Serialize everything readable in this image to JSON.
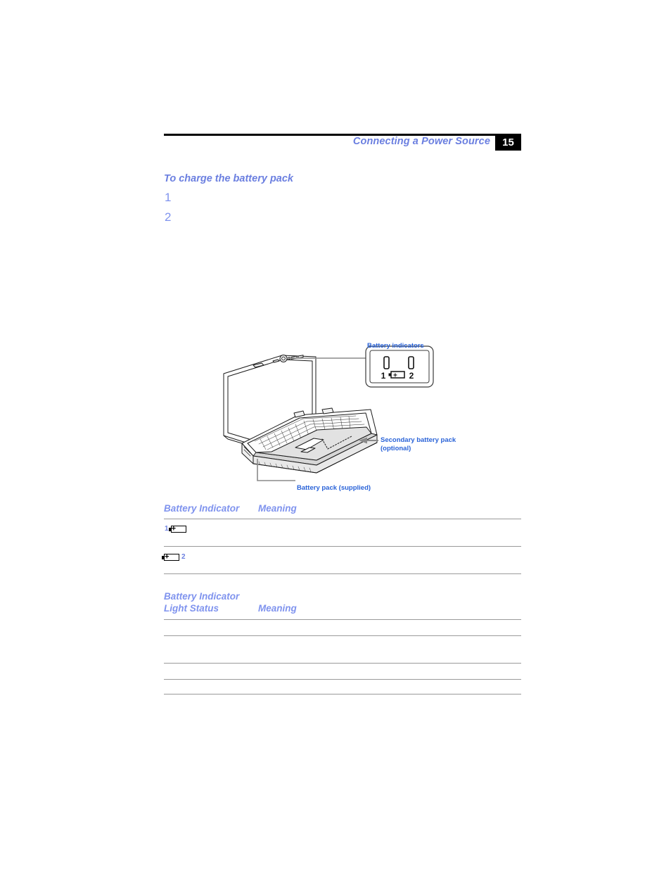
{
  "header": {
    "title": "Connecting a Power Source",
    "page_number": "15"
  },
  "procedure": {
    "heading": "To charge the battery pack",
    "steps": [
      "1",
      "2"
    ]
  },
  "figure": {
    "callout_box_label": "Battery indicators",
    "indicator_left_number": "1",
    "indicator_right_number": "2",
    "arrow_label_line1": "Secondary battery pack",
    "arrow_label_line2": "(optional)",
    "leader_label": "Battery pack (supplied)"
  },
  "table_one": {
    "headers": [
      "Battery Indicator",
      "Meaning"
    ],
    "rows": [
      {
        "indicator_number": "1",
        "number_position": "before",
        "meaning": ""
      },
      {
        "indicator_number": "2",
        "number_position": "after",
        "meaning": ""
      }
    ]
  },
  "table_two": {
    "header_line1": "Battery Indicator",
    "header_line2": "Light Status",
    "header_meaning": "Meaning",
    "rows": [
      {
        "light_status": "",
        "meaning": ""
      },
      {
        "light_status": "",
        "meaning": ""
      },
      {
        "light_status": "",
        "meaning": ""
      },
      {
        "light_status": "",
        "meaning": ""
      }
    ]
  },
  "colors": {
    "accent_blue": "#6b7fe0",
    "label_blue": "#2a63d8",
    "rule_gray": "#9a9a9a",
    "header_rule": "#000000"
  }
}
